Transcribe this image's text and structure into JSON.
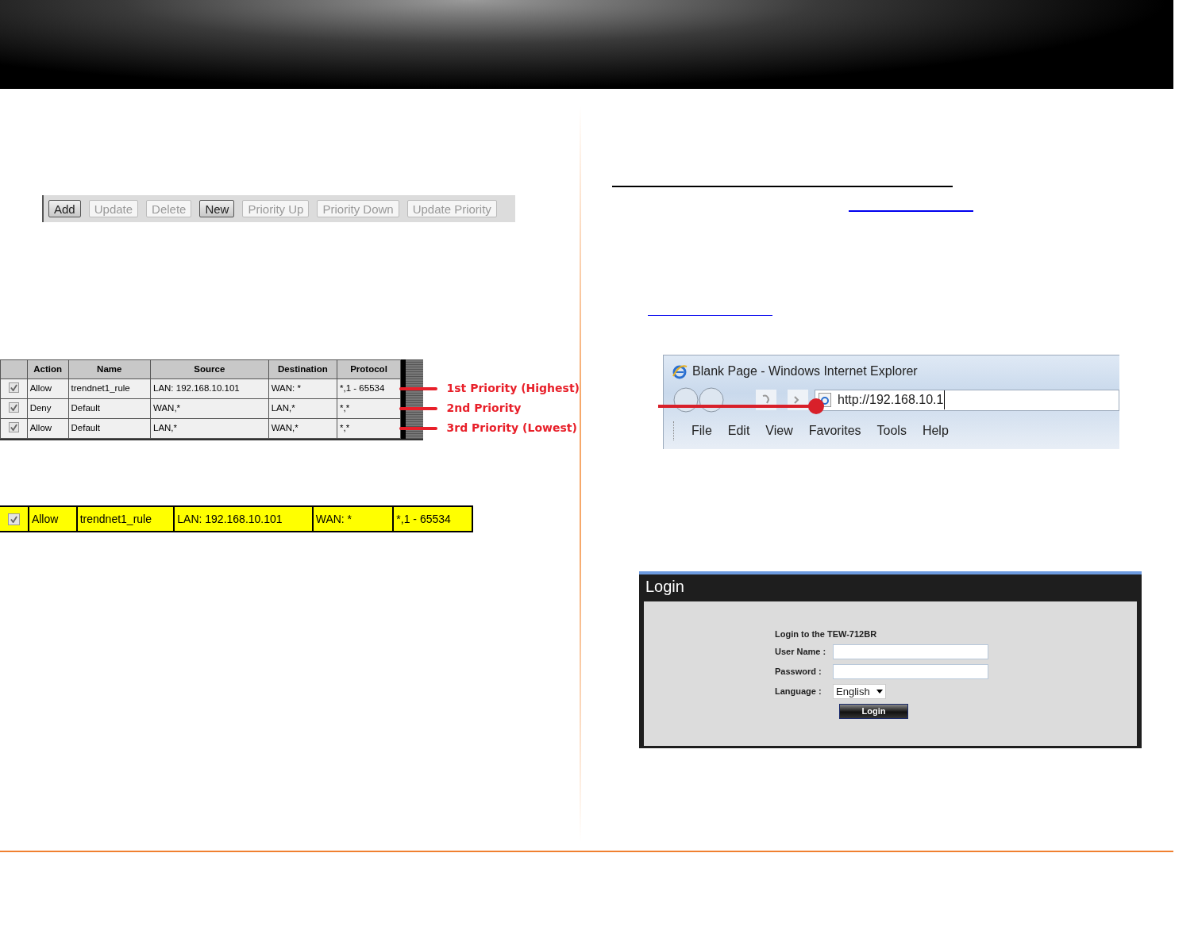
{
  "toolbar": {
    "buttons": [
      {
        "label": "Add",
        "disabled": false
      },
      {
        "label": "Update",
        "disabled": true
      },
      {
        "label": "Delete",
        "disabled": true
      },
      {
        "label": "New",
        "disabled": false
      },
      {
        "label": "Priority Up",
        "disabled": true
      },
      {
        "label": "Priority Down",
        "disabled": true
      },
      {
        "label": "Update Priority",
        "disabled": true
      }
    ]
  },
  "rules_table": {
    "columns": [
      "Action",
      "Name",
      "Source",
      "Destination",
      "Protocol"
    ],
    "rows": [
      {
        "checked": true,
        "cells": [
          "Allow",
          "trendnet1_rule",
          "LAN: 192.168.10.101",
          "WAN: *",
          "*,1 - 65534"
        ],
        "annotation": "1st Priority (Highest)"
      },
      {
        "checked": true,
        "cells": [
          "Deny",
          "Default",
          "WAN,*",
          "LAN,*",
          "*,*"
        ],
        "annotation": "2nd Priority"
      },
      {
        "checked": true,
        "cells": [
          "Allow",
          "Default",
          "LAN,*",
          "WAN,*",
          "*,*"
        ],
        "annotation": "3rd Priority (Lowest)"
      }
    ]
  },
  "highlighted_row": {
    "checked": true,
    "cells": [
      "Allow",
      "trendnet1_rule",
      "LAN: 192.168.10.101",
      "WAN: *",
      "*,1 - 65534"
    ]
  },
  "browser": {
    "title": "Blank Page - Windows Internet Explorer",
    "url": "http://192.168.10.1",
    "menu": [
      "File",
      "Edit",
      "View",
      "Favorites",
      "Tools",
      "Help"
    ]
  },
  "login": {
    "title": "Login",
    "heading": "Login to the TEW-712BR",
    "fields": [
      {
        "kind": "text",
        "label": "User Name :"
      },
      {
        "kind": "password",
        "label": "Password :"
      },
      {
        "kind": "select",
        "label": "Language :",
        "value": "English"
      }
    ],
    "button": "Login"
  }
}
